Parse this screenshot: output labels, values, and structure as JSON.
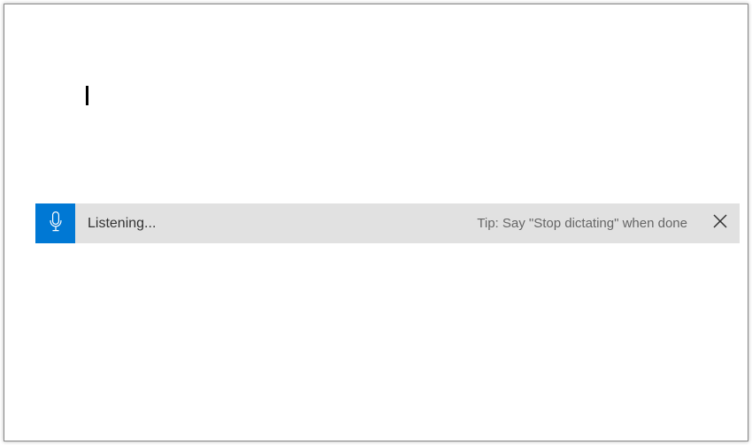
{
  "dictation": {
    "status_text": "Listening...",
    "tip_text": "Tip: Say \"Stop dictating\" when done"
  },
  "document": {
    "content": ""
  }
}
